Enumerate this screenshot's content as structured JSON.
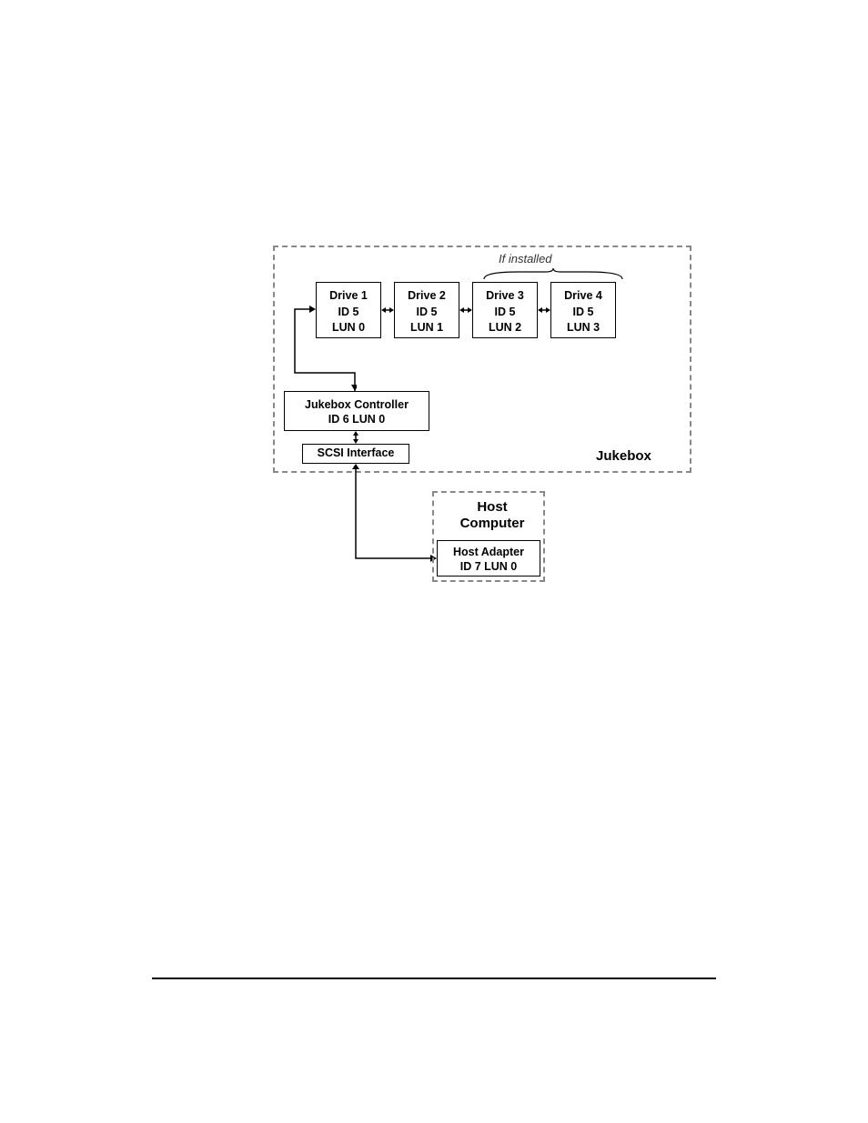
{
  "diagram": {
    "if_installed_label": "If installed",
    "drives": [
      {
        "name": "Drive 1",
        "id": "ID 5",
        "lun": "LUN 0"
      },
      {
        "name": "Drive 2",
        "id": "ID 5",
        "lun": "LUN 1"
      },
      {
        "name": "Drive 3",
        "id": "ID 5",
        "lun": "LUN 2"
      },
      {
        "name": "Drive 4",
        "id": "ID 5",
        "lun": "LUN 3"
      }
    ],
    "controller": {
      "title": "Jukebox Controller",
      "id_lun": "ID 6  LUN 0"
    },
    "scsi": "SCSI Interface",
    "jukebox_label": "Jukebox",
    "host_label": "Host Computer",
    "adapter": {
      "title": "Host Adapter",
      "id_lun": "ID 7 LUN 0"
    }
  }
}
